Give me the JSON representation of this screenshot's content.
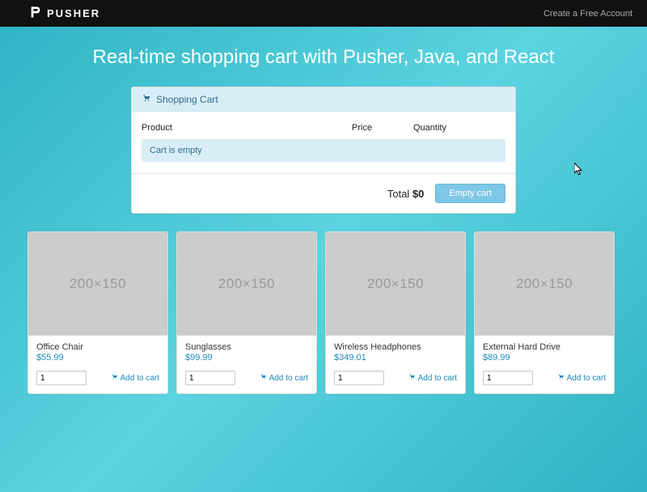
{
  "navbar": {
    "brand": "PUSHER",
    "create_account": "Create a Free Account"
  },
  "page_title": "Real-time shopping cart with Pusher, Java, and React",
  "cart": {
    "header": "Shopping Cart",
    "cols": {
      "product": "Product",
      "price": "Price",
      "qty": "Quantity"
    },
    "empty_msg": "Cart is empty",
    "total_label": "Total",
    "total_value": "$0",
    "empty_btn": "Empty cart"
  },
  "product_placeholder": "200×150",
  "products": [
    {
      "name": "Office Chair",
      "price": "$55.99",
      "qty": "1",
      "add": "Add to cart"
    },
    {
      "name": "Sunglasses",
      "price": "$99.99",
      "qty": "1",
      "add": "Add to cart"
    },
    {
      "name": "Wireless Headphones",
      "price": "$349.01",
      "qty": "1",
      "add": "Add to cart"
    },
    {
      "name": "External Hard Drive",
      "price": "$89.99",
      "qty": "1",
      "add": "Add to cart"
    }
  ]
}
